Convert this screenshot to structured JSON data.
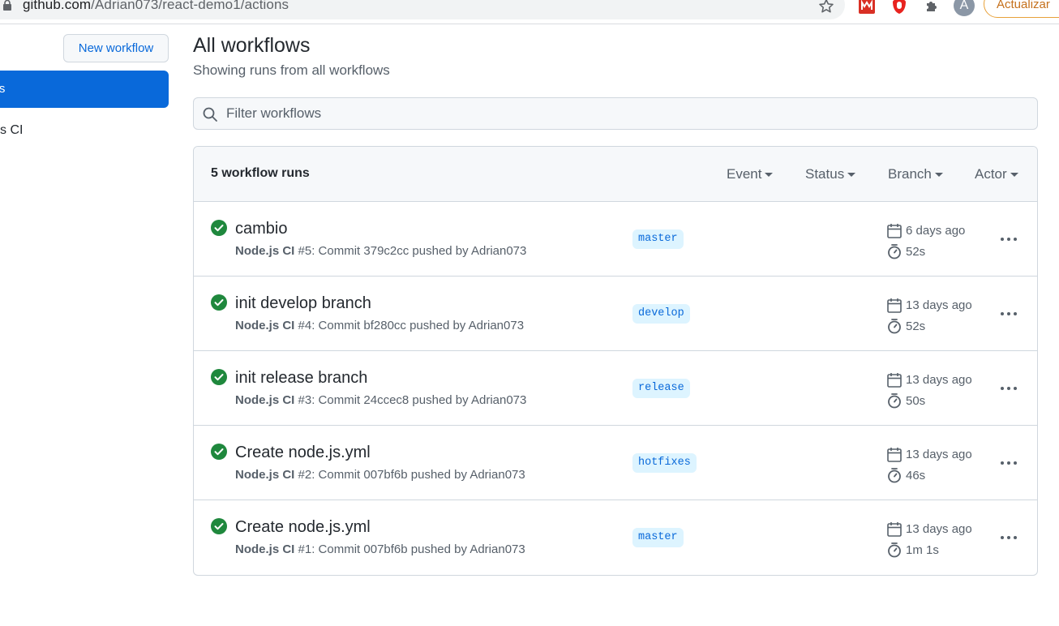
{
  "browser": {
    "url_host": "github.com",
    "url_path": "/Adrian073/react-demo1/actions",
    "avatar_letter": "A",
    "update_label": "Actualizar"
  },
  "sidebar": {
    "new_workflow_label": "New workflow",
    "active_item_label": "ws",
    "item_label": "s CI"
  },
  "main": {
    "title": "All workflows",
    "subtitle": "Showing runs from all workflows",
    "filter_placeholder": "Filter workflows"
  },
  "runs_header": {
    "count_label": "5 workflow runs",
    "filters": [
      "Event",
      "Status",
      "Branch",
      "Actor"
    ]
  },
  "runs": [
    {
      "title": "cambio",
      "workflow": "Node.js CI",
      "detail": "#5: Commit 379c2cc pushed by Adrian073",
      "branch": "master",
      "date": "6 days ago",
      "duration": "52s"
    },
    {
      "title": "init develop branch",
      "workflow": "Node.js CI",
      "detail": "#4: Commit bf280cc pushed by Adrian073",
      "branch": "develop",
      "date": "13 days ago",
      "duration": "52s"
    },
    {
      "title": "init release branch",
      "workflow": "Node.js CI",
      "detail": "#3: Commit 24ccec8 pushed by Adrian073",
      "branch": "release",
      "date": "13 days ago",
      "duration": "50s"
    },
    {
      "title": "Create node.js.yml",
      "workflow": "Node.js CI",
      "detail": "#2: Commit 007bf6b pushed by Adrian073",
      "branch": "hotfixes",
      "date": "13 days ago",
      "duration": "46s"
    },
    {
      "title": "Create node.js.yml",
      "workflow": "Node.js CI",
      "detail": "#1: Commit 007bf6b pushed by Adrian073",
      "branch": "master",
      "date": "13 days ago",
      "duration": "1m 1s"
    }
  ],
  "colors": {
    "accent": "#0969da",
    "success": "#1a7f37",
    "branch_bg": "#ddf4ff",
    "update_border": "#e8a13a"
  }
}
